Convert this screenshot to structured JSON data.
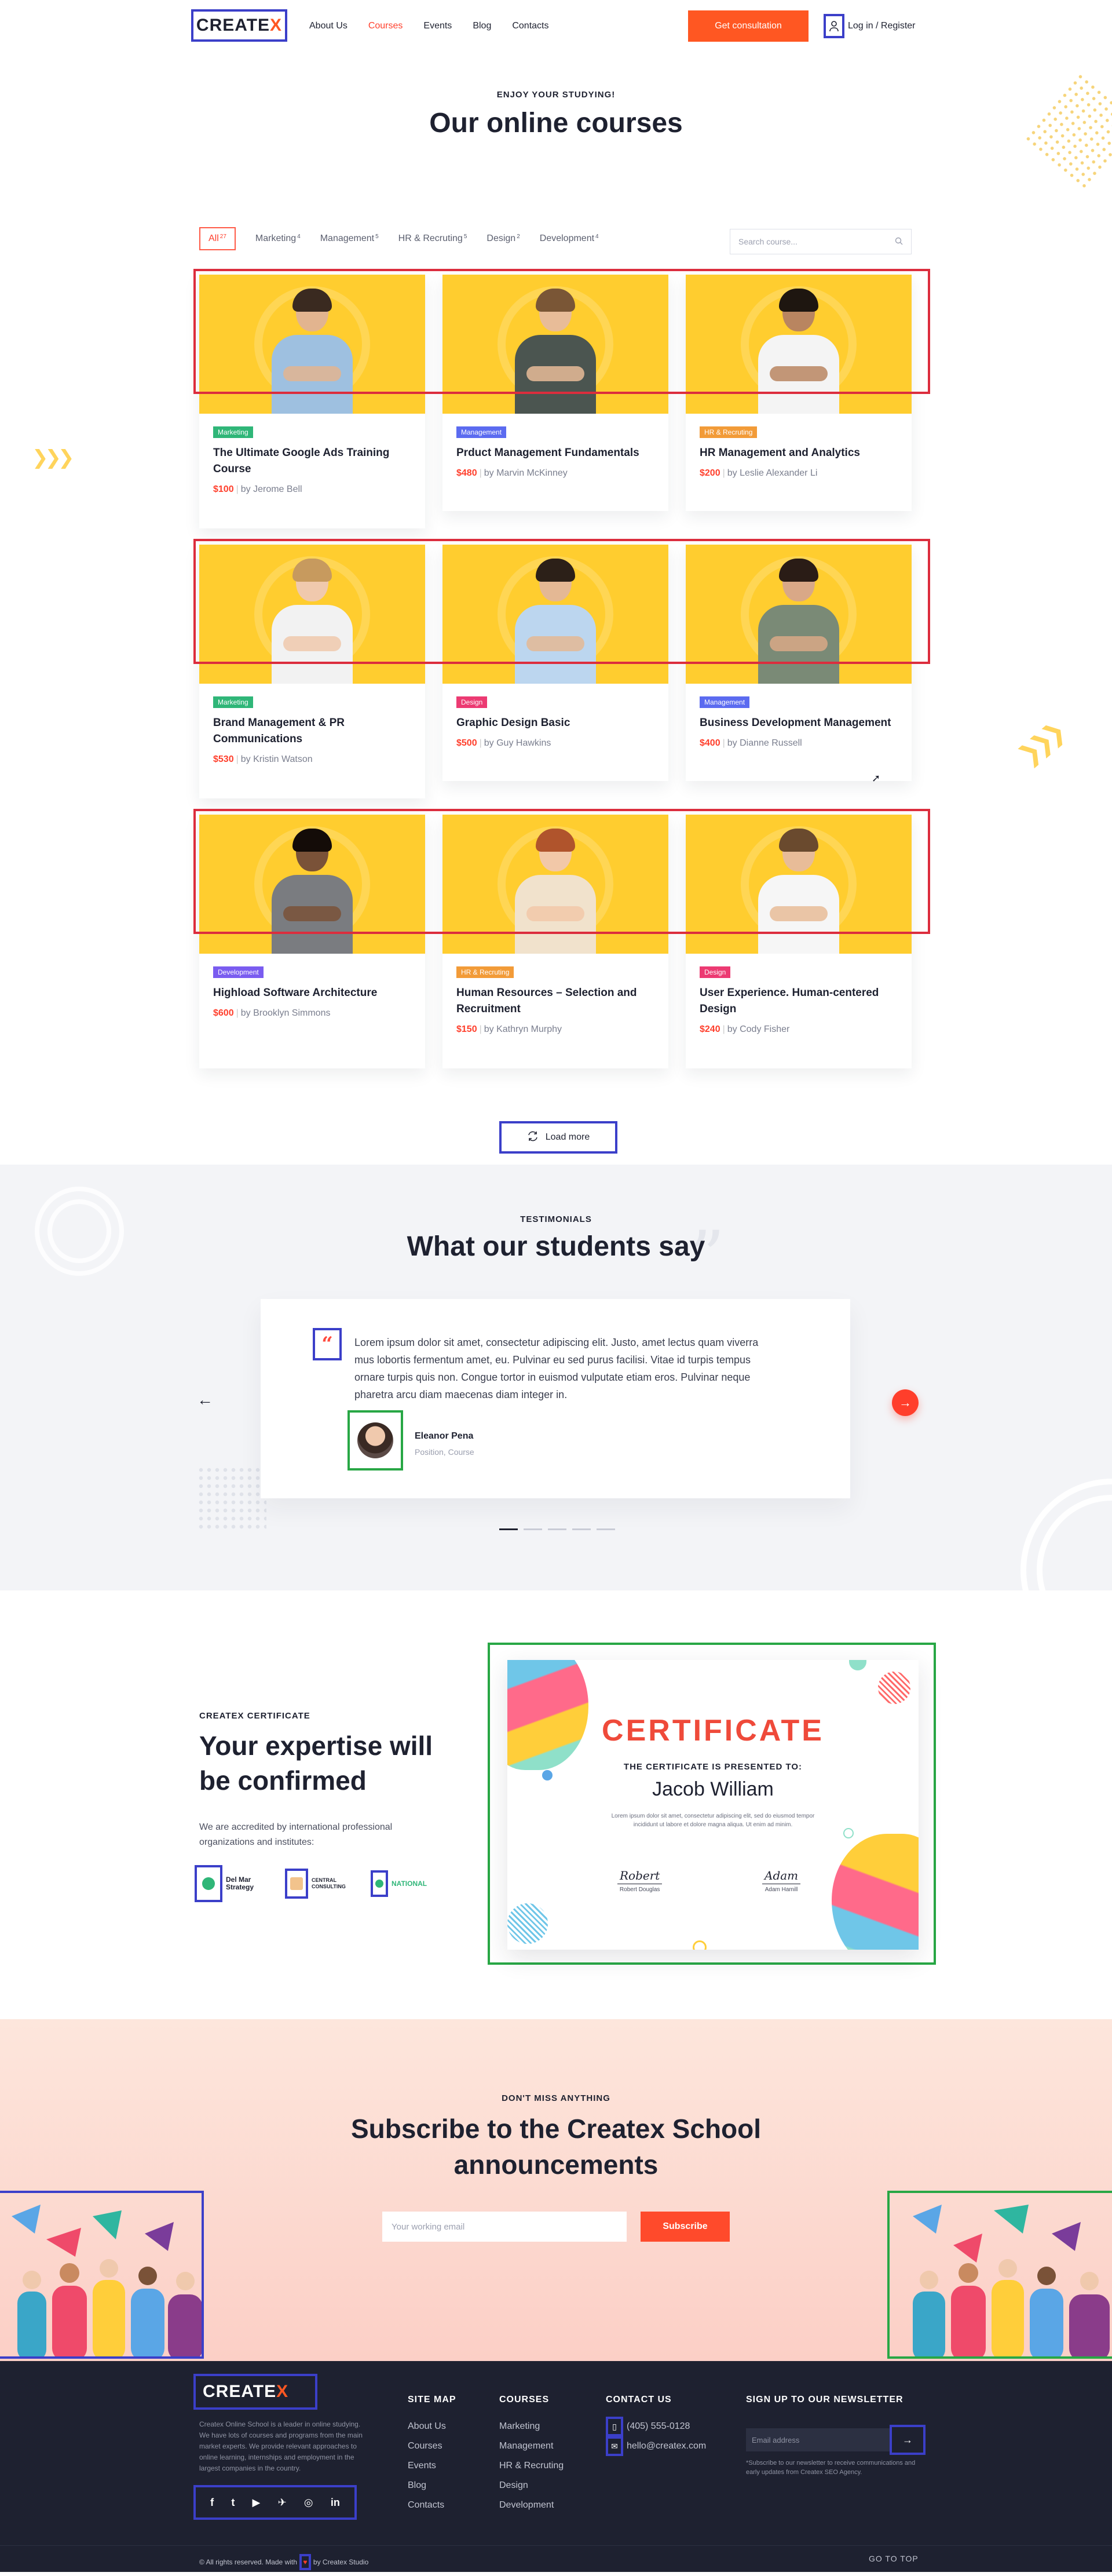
{
  "header": {
    "logo": "CREATE",
    "logo_accent": "X",
    "nav": [
      "About Us",
      "Courses",
      "Events",
      "Blog",
      "Contacts"
    ],
    "active_nav": "Courses",
    "cta": "Get consultation",
    "login": "Log in / Register",
    "accent_color": "#ff5722"
  },
  "courses": {
    "eyebrow": "Enjoy your studying!",
    "title": "Our online courses",
    "filters": [
      {
        "label": "All",
        "count": "27"
      },
      {
        "label": "Marketing",
        "count": "4"
      },
      {
        "label": "Management",
        "count": "5"
      },
      {
        "label": "HR & Recruting",
        "count": "5"
      },
      {
        "label": "Design",
        "count": "2"
      },
      {
        "label": "Development",
        "count": "4"
      }
    ],
    "search_placeholder": "Search course...",
    "items": [
      {
        "tag": "Marketing",
        "tag_color": "#2fb678",
        "title": "The Ultimate Google Ads Training Course",
        "price": "$100",
        "author": "by Jerome Bell",
        "shirt": "#9ec0e0",
        "hair": "#3a2a20",
        "skin": "#e2b48f"
      },
      {
        "tag": "Management",
        "tag_color": "#5b6bf0",
        "title": "Prduct Management Fundamentals",
        "price": "$480",
        "author": "by Marvin McKinney",
        "shirt": "#4b5550",
        "hair": "#7a5636",
        "skin": "#e8bc98"
      },
      {
        "tag": "HR & Recruting",
        "tag_color": "#f29b38",
        "title": "HR  Management and Analytics",
        "price": "$200",
        "author": "by Leslie Alexander Li",
        "shirt": "#f4f4f4",
        "hair": "#1e1610",
        "skin": "#b98560"
      },
      {
        "tag": "Marketing",
        "tag_color": "#2fb678",
        "title": "Brand Management & PR Communications",
        "price": "$530",
        "author": "by Kristin Watson",
        "shirt": "#f2f2f2",
        "hair": "#c79a5e",
        "skin": "#f0c9ad"
      },
      {
        "tag": "Design",
        "tag_color": "#ec3a72",
        "title": "Graphic Design Basic",
        "price": "$500",
        "author": "by Guy Hawkins",
        "shirt": "#bcd6ef",
        "hair": "#2c2018",
        "skin": "#e4b894"
      },
      {
        "tag": "Management",
        "tag_color": "#5b6bf0",
        "title": "Business Development Management",
        "price": "$400",
        "author": "by Dianne Russell",
        "shirt": "#7a8a76",
        "hair": "#2a1c16",
        "skin": "#d9a887"
      },
      {
        "tag": "Development",
        "tag_color": "#7a5cf0",
        "title": "Highload Software Architecture",
        "price": "$600",
        "author": "by Brooklyn Simmons",
        "shirt": "#7a7c80",
        "hair": "#140c08",
        "skin": "#7a5238"
      },
      {
        "tag": "HR & Recruting",
        "tag_color": "#f29b38",
        "title": "Human Resources – Selection and Recruitment",
        "price": "$150",
        "author": "by Kathryn Murphy",
        "shirt": "#f1e2cc",
        "hair": "#b0542c",
        "skin": "#f2c8a8"
      },
      {
        "tag": "Design",
        "tag_color": "#ec3a72",
        "title": "User Experience. Human-centered Design",
        "price": "$240",
        "author": "by Cody Fisher",
        "shirt": "#f6f6f6",
        "hair": "#6a4a2e",
        "skin": "#e8bc98"
      }
    ],
    "load_more": "Load more"
  },
  "testimonials": {
    "eyebrow": "Testimonials",
    "title": "What our students say",
    "quote": "Lorem ipsum dolor sit amet, consectetur adipiscing elit. Justo, amet lectus quam viverra mus lobortis fermentum amet, eu. Pulvinar eu sed purus facilisi. Vitae id turpis tempus ornare turpis quis non. Congue tortor in euismod vulputate etiam eros. Pulvinar neque pharetra arcu diam maecenas diam integer in.",
    "name": "Eleanor Pena",
    "position": "Position, Course",
    "slides": 5,
    "active_slide": 1
  },
  "certificate": {
    "eyebrow": "Createx Certificate",
    "title": "Your expertise will be confirmed",
    "description": "We are accredited by international professional organizations and institutes:",
    "partners": [
      "Del Mar Strategy",
      "Central Consulting",
      "National"
    ],
    "cert_title": "CERTIFICATE",
    "cert_sub": "THE CERTIFICATE IS PRESENTED TO:",
    "cert_name": "Jacob William",
    "cert_body": "Lorem ipsum dolor sit amet, consectetur adipiscing elit, sed do eiusmod tempor incididunt ut labore et dolore magna aliqua. Ut enim ad minim.",
    "signatures": [
      {
        "sign": "Robert",
        "name": "Robert Douglas"
      },
      {
        "sign": "Adam",
        "name": "Adam Hamill"
      }
    ]
  },
  "subscribe": {
    "eyebrow": "Don't miss anything",
    "title": "Subscribe to the Createx School announcements",
    "placeholder": "Your working email",
    "button": "Subscribe"
  },
  "footer": {
    "logo": "CREATE",
    "logo_accent": "X",
    "about": "Createx Online School is a leader in online studying. We have lots of courses and programs from the main market experts. We provide relevant approaches to online learning, internships and employment in the largest companies in the country.",
    "socials": [
      "f",
      "t",
      "▶",
      "✈",
      "◎",
      "in"
    ],
    "site_map_title": "SITE MAP",
    "site_map": [
      "About Us",
      "Courses",
      "Events",
      "Blog",
      "Contacts"
    ],
    "courses_title": "COURSES",
    "courses": [
      "Marketing",
      "Management",
      "HR & Recruting",
      "Design",
      "Development"
    ],
    "contact_title": "CONTACT US",
    "phone": "(405) 555-0128",
    "email": "hello@createx.com",
    "newsletter_title": "SIGN UP TO OUR NEWSLETTER",
    "newsletter_placeholder": "Email address",
    "newsletter_note": "*Subscribe to our newsletter to receive communications and early updates from Createx SEO Agency.",
    "copyright_pre": "© All rights reserved. Made with",
    "copyright_post": "by Createx Studio",
    "go_top": "GO TO TOP"
  }
}
